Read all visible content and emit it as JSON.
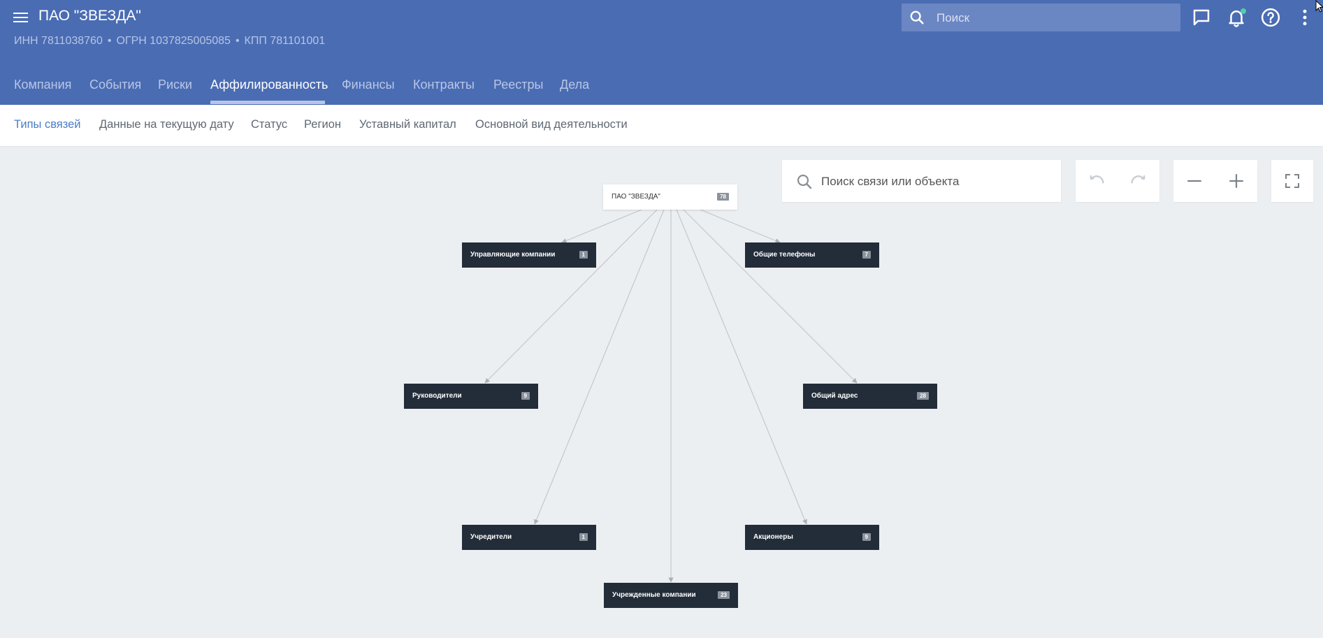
{
  "header": {
    "title": "ПАО \"ЗВЕЗДА\"",
    "inn": "ИНН 7811038760",
    "ogrn": "ОГРН 1037825005085",
    "kpp": "КПП 781101001",
    "separator": "•",
    "search_placeholder": "Поиск"
  },
  "tabs": [
    {
      "label": "Компания"
    },
    {
      "label": "События"
    },
    {
      "label": "Риски"
    },
    {
      "label": "Аффилированность"
    },
    {
      "label": "Финансы"
    },
    {
      "label": "Контракты"
    },
    {
      "label": "Реестры"
    },
    {
      "label": "Дела"
    }
  ],
  "active_tab": "Аффилированность",
  "filters": [
    {
      "label": "Типы связей"
    },
    {
      "label": "Данные на текущую дату"
    },
    {
      "label": "Статус"
    },
    {
      "label": "Регион"
    },
    {
      "label": "Уставный капитал"
    },
    {
      "label": "Основной вид деятельности"
    }
  ],
  "active_filter": "Типы связей",
  "graph": {
    "search_placeholder": "Поиск связи или объекта",
    "root": {
      "label": "ПАО \"ЗВЕЗДА\"",
      "count": "78"
    },
    "nodes": [
      {
        "label": "Управляющие компании",
        "count": "1"
      },
      {
        "label": "Общие телефоны",
        "count": "7"
      },
      {
        "label": "Руководители",
        "count": "9"
      },
      {
        "label": "Общий адрес",
        "count": "28"
      },
      {
        "label": "Учредители",
        "count": "1"
      },
      {
        "label": "Акционеры",
        "count": "9"
      },
      {
        "label": "Учрежденные компании",
        "count": "23"
      }
    ]
  },
  "colors": {
    "header": "#4a6cb3",
    "node_dark": "#232d39",
    "active_filter": "#4a7cc9",
    "notification_dot": "#4fd1a8"
  }
}
